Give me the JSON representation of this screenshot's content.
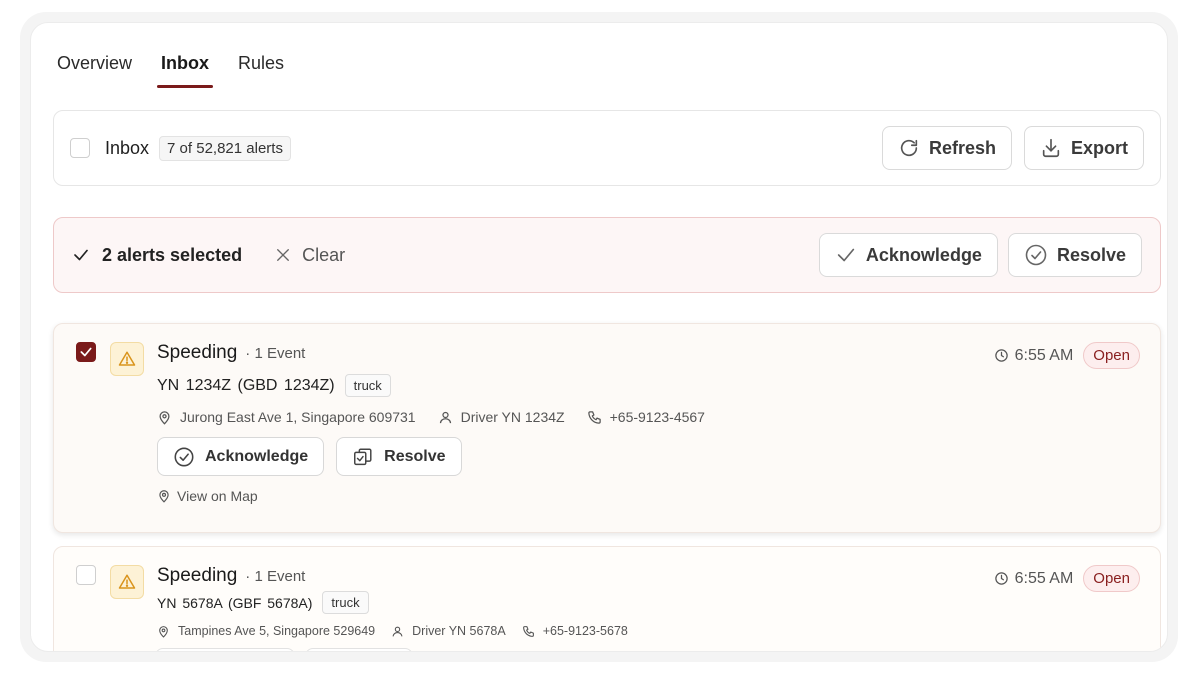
{
  "tabs": [
    {
      "label": "Overview",
      "active": false
    },
    {
      "label": "Inbox",
      "active": true
    },
    {
      "label": "Rules",
      "active": false
    }
  ],
  "inbox_bar": {
    "title": "Inbox",
    "count_label": "7 of 52,821 alerts",
    "refresh_label": "Refresh",
    "export_label": "Export"
  },
  "selection_bar": {
    "selected_label": "2 alerts selected",
    "clear_label": "Clear",
    "acknowledge_label": "Acknowledge",
    "resolve_label": "Resolve"
  },
  "alerts": [
    {
      "checked": true,
      "title": "Speeding",
      "events": "· 1 Event",
      "vehicle": "YN 1234Z  (GBD 1234Z)",
      "tag": "truck",
      "location": "Jurong East Ave 1, Singapore 609731",
      "driver": "Driver YN 1234Z",
      "phone": "+65-9123-4567",
      "time": "6:55 AM",
      "status": "Open",
      "acknowledge_label": "Acknowledge",
      "resolve_label": "Resolve",
      "map_label": "View on Map"
    },
    {
      "checked": false,
      "title": "Speeding",
      "events": "· 1 Event",
      "vehicle": "YN 5678A (GBF 5678A)",
      "tag": "truck",
      "location": "Tampines Ave 5, Singapore 529649",
      "driver": "Driver YN 5678A",
      "phone": "+65-9123-5678",
      "time": "6:55 AM",
      "status": "Open"
    }
  ],
  "colors": {
    "accent": "#7a1a1a",
    "warning_bg": "#fdf2d6",
    "warning_icon": "#d9941c",
    "status_text": "#8a2020"
  }
}
